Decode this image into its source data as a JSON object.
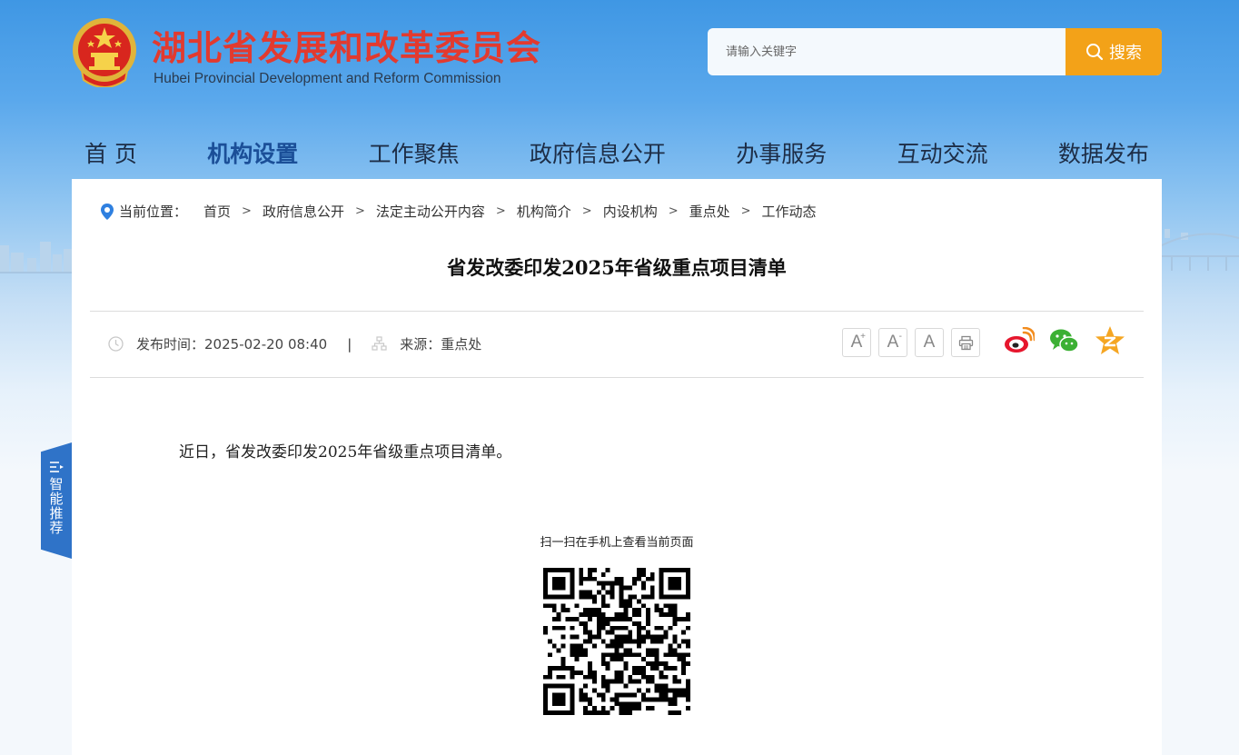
{
  "header": {
    "title_cn": "湖北省发展和改革委员会",
    "title_en": "Hubei Provincial Development and Reform Commission",
    "search_placeholder": "请输入关键字",
    "search_label": "搜索"
  },
  "nav": [
    "首 页",
    "机构设置",
    "工作聚焦",
    "政府信息公开",
    "办事服务",
    "互动交流",
    "数据发布"
  ],
  "nav_active_index": 1,
  "breadcrumb": {
    "label": "当前位置：",
    "items": [
      "首页",
      "政府信息公开",
      "法定主动公开内容",
      "机构简介",
      "内设机构",
      "重点处",
      "工作动态"
    ],
    "separator": ">"
  },
  "article": {
    "title": "省发改委印发2025年省级重点项目清单",
    "publish_label": "发布时间：",
    "publish_time": "2025-02-20 08:40",
    "divider": "|",
    "source_label": "来源：",
    "source": "重点处",
    "body": "近日，省发改委印发2025年省级重点项目清单。"
  },
  "tools": {
    "font_increase": "A",
    "font_decrease": "A",
    "font_default": "A",
    "increase_mark": "+",
    "decrease_mark": "-"
  },
  "share": {
    "icons": [
      "weibo-icon",
      "wechat-icon",
      "qzone-icon"
    ],
    "colors": {
      "weibo": "#e6162d",
      "wechat": "#3cb034",
      "qzone": "#f5a623"
    }
  },
  "qr": {
    "caption": "扫一扫在手机上查看当前页面"
  },
  "side_tab": {
    "label": "智能推荐"
  },
  "colors": {
    "title_red": "#e23a2f",
    "search_orange": "#f3a218",
    "nav_active": "#1b4f98",
    "side_tab": "#2f73c8"
  }
}
